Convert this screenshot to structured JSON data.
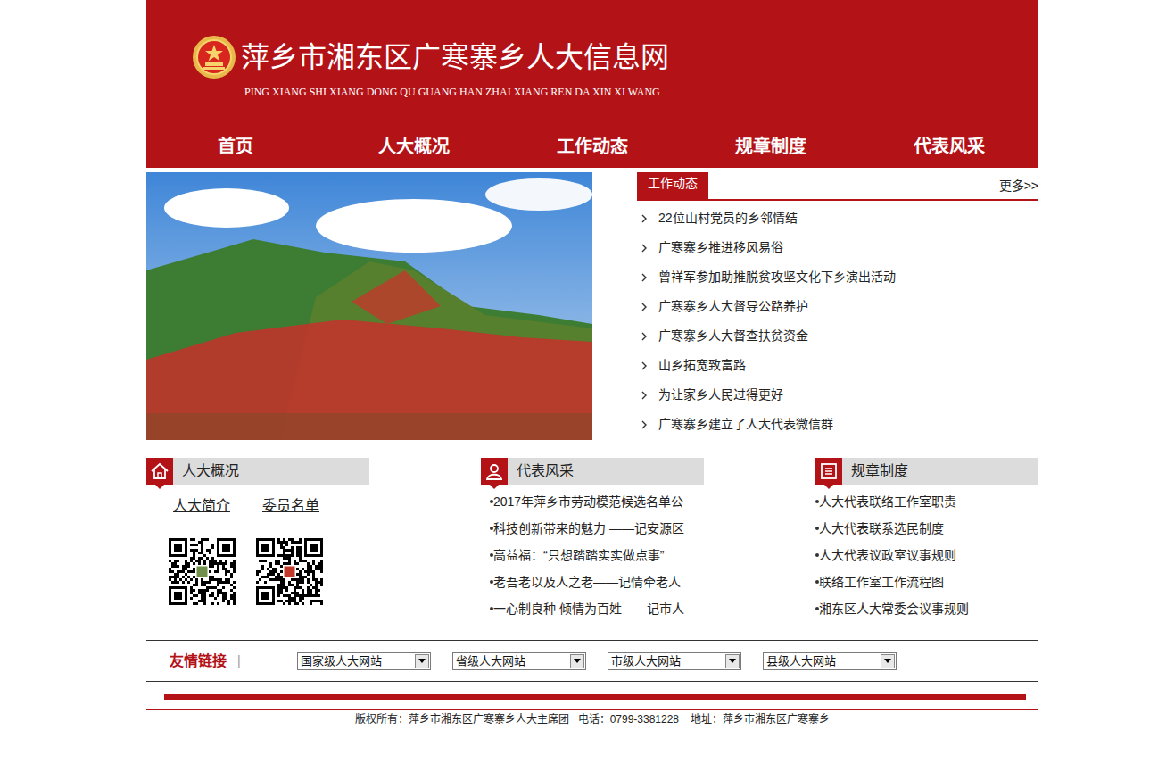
{
  "site": {
    "title": "萍乡市湘东区广寒寨乡人大信息网",
    "subtitle": "PING XIANG SHI XIANG DONG QU GUANG HAN ZHAI XIANG REN DA XIN XI WANG"
  },
  "nav": [
    "首页",
    "人大概况",
    "工作动态",
    "规章制度",
    "代表风采"
  ],
  "news": {
    "tab": "工作动态",
    "more": "更多>>",
    "items": [
      "22位山村党员的乡邻情结",
      "广寒寨乡推进移风易俗",
      "曾祥军参加助推脱贫攻坚文化下乡演出活动",
      "广寒寨乡人大督导公路养护",
      "广寒寨乡人大督查扶贫资金",
      "山乡拓宽致富路",
      "为让家乡人民过得更好",
      "广寒寨乡建立了人大代表微信群"
    ]
  },
  "overview": {
    "title": "人大概况",
    "links": [
      "人大简介",
      "委员名单"
    ]
  },
  "deputies": {
    "title": "代表风采",
    "items": [
      "2017年萍乡市劳动模范候选名单公",
      "科技创新带来的魅力 ——记安源区",
      "高益福：“只想踏踏实实做点事”",
      "老吾老以及人之老——记情牵老人",
      "一心制良种 倾情为百姓——记市人"
    ]
  },
  "rules": {
    "title": "规章制度",
    "items": [
      "人大代表联络工作室职责",
      "人大代表联系选民制度",
      "人大代表议政室议事规则",
      "联络工作室工作流程图",
      "湘东区人大常委会议事规则"
    ]
  },
  "friend_links": {
    "label": "友情链接",
    "separator": "|",
    "selects": [
      "国家级人大网站",
      "省级人大网站",
      "市级人大网站",
      "县级人大网站"
    ]
  },
  "footer": "版权所有：萍乡市湘东区广寒寨乡人大主席团   电话：0799-3381228    地址：萍乡市湘东区广寒寨乡"
}
